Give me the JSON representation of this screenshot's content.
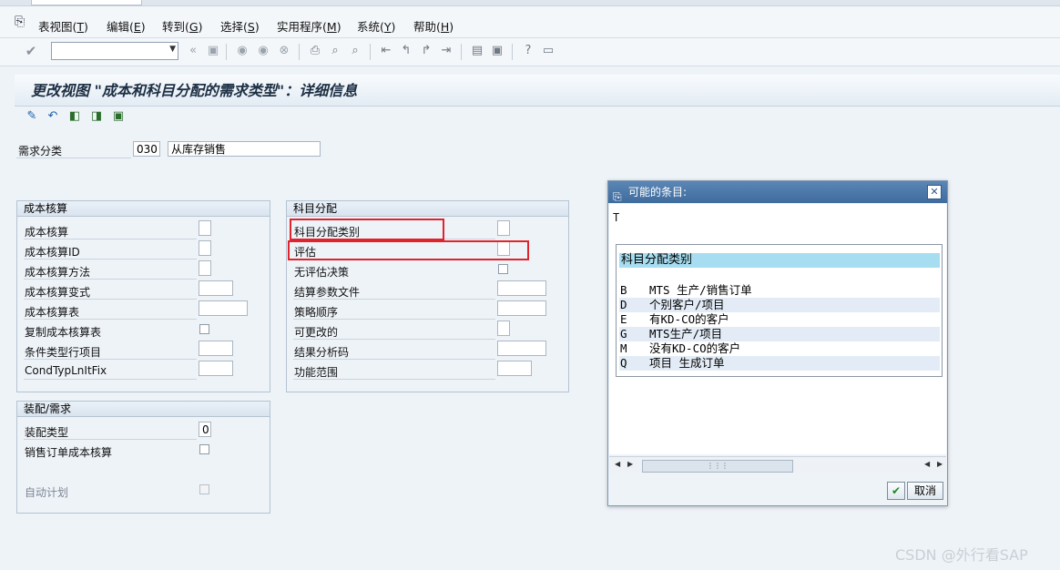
{
  "menubar": {
    "items": [
      {
        "label": "表视图(",
        "key": "T",
        "suffix": ")"
      },
      {
        "label": "编辑(",
        "key": "E",
        "suffix": ")"
      },
      {
        "label": "转到(",
        "key": "G",
        "suffix": ")"
      },
      {
        "label": "选择(",
        "key": "S",
        "suffix": ")"
      },
      {
        "label": "实用程序(",
        "key": "M",
        "suffix": ")"
      },
      {
        "label": "系统(",
        "key": "Y",
        "suffix": ")"
      },
      {
        "label": "帮助(",
        "key": "H",
        "suffix": ")"
      }
    ]
  },
  "toolbar": {
    "command_value": "",
    "icons": [
      "check-icon",
      "prev-icon",
      "save-icon",
      "back-icon",
      "exit-icon",
      "cancel-icon",
      "print-icon",
      "find-icon",
      "find-next-icon",
      "first-page-icon",
      "prev-page-icon",
      "next-page-icon",
      "last-page-icon",
      "new-session-icon",
      "shortcut-icon",
      "help-icon",
      "layout-icon"
    ]
  },
  "page": {
    "title": "更改视图 \"成本和科目分配的需求类型\"：详细信息"
  },
  "header_fields": {
    "req_class_label": "需求分类",
    "req_class_code": "030",
    "req_class_desc": "从库存销售"
  },
  "costing": {
    "title": "成本核算",
    "rows": [
      {
        "label": "成本核算",
        "type": "small"
      },
      {
        "label": "成本核算ID",
        "type": "small"
      },
      {
        "label": "成本核算方法",
        "type": "small"
      },
      {
        "label": "成本核算变式",
        "type": "medium"
      },
      {
        "label": "成本核算表",
        "type": "large"
      },
      {
        "label": "复制成本核算表",
        "type": "check"
      },
      {
        "label": "条件类型行项目",
        "type": "medium"
      },
      {
        "label": "CondTypLnItFix",
        "type": "medium"
      }
    ]
  },
  "acct": {
    "title": "科目分配",
    "rows": [
      {
        "label": "科目分配类别",
        "type": "small"
      },
      {
        "label": "评估",
        "type": "small"
      },
      {
        "label": "无评估决策",
        "type": "check"
      },
      {
        "label": "结算参数文件",
        "type": "large"
      },
      {
        "label": "策略顺序",
        "type": "large"
      },
      {
        "label": "可更改的",
        "type": "small"
      },
      {
        "label": "结果分析码",
        "type": "large"
      },
      {
        "label": "功能范围",
        "type": "medium"
      }
    ]
  },
  "assembly": {
    "title": "装配/需求",
    "rows": [
      {
        "label": "装配类型",
        "value": "0"
      },
      {
        "label": "销售订单成本核算"
      },
      {
        "label": "自动计划"
      }
    ]
  },
  "popup": {
    "title": "可能的条目:",
    "input_value": "T",
    "list_header": "科目分配类别",
    "items": [
      {
        "key": "B",
        "text": "MTS 生产/销售订单"
      },
      {
        "key": "D",
        "text": "个别客户/项目"
      },
      {
        "key": "E",
        "text": "有KD-CO的客户"
      },
      {
        "key": "G",
        "text": "MTS生产/项目"
      },
      {
        "key": "M",
        "text": "没有KD-CO的客户"
      },
      {
        "key": "Q",
        "text": "项目 生成订单"
      }
    ],
    "cancel_label": "取消"
  },
  "watermark": "CSDN @外行看SAP",
  "colors": {
    "accent_red": "#e0242c",
    "popup_title": "#4a77a8",
    "list_header": "#a6ddf0"
  }
}
